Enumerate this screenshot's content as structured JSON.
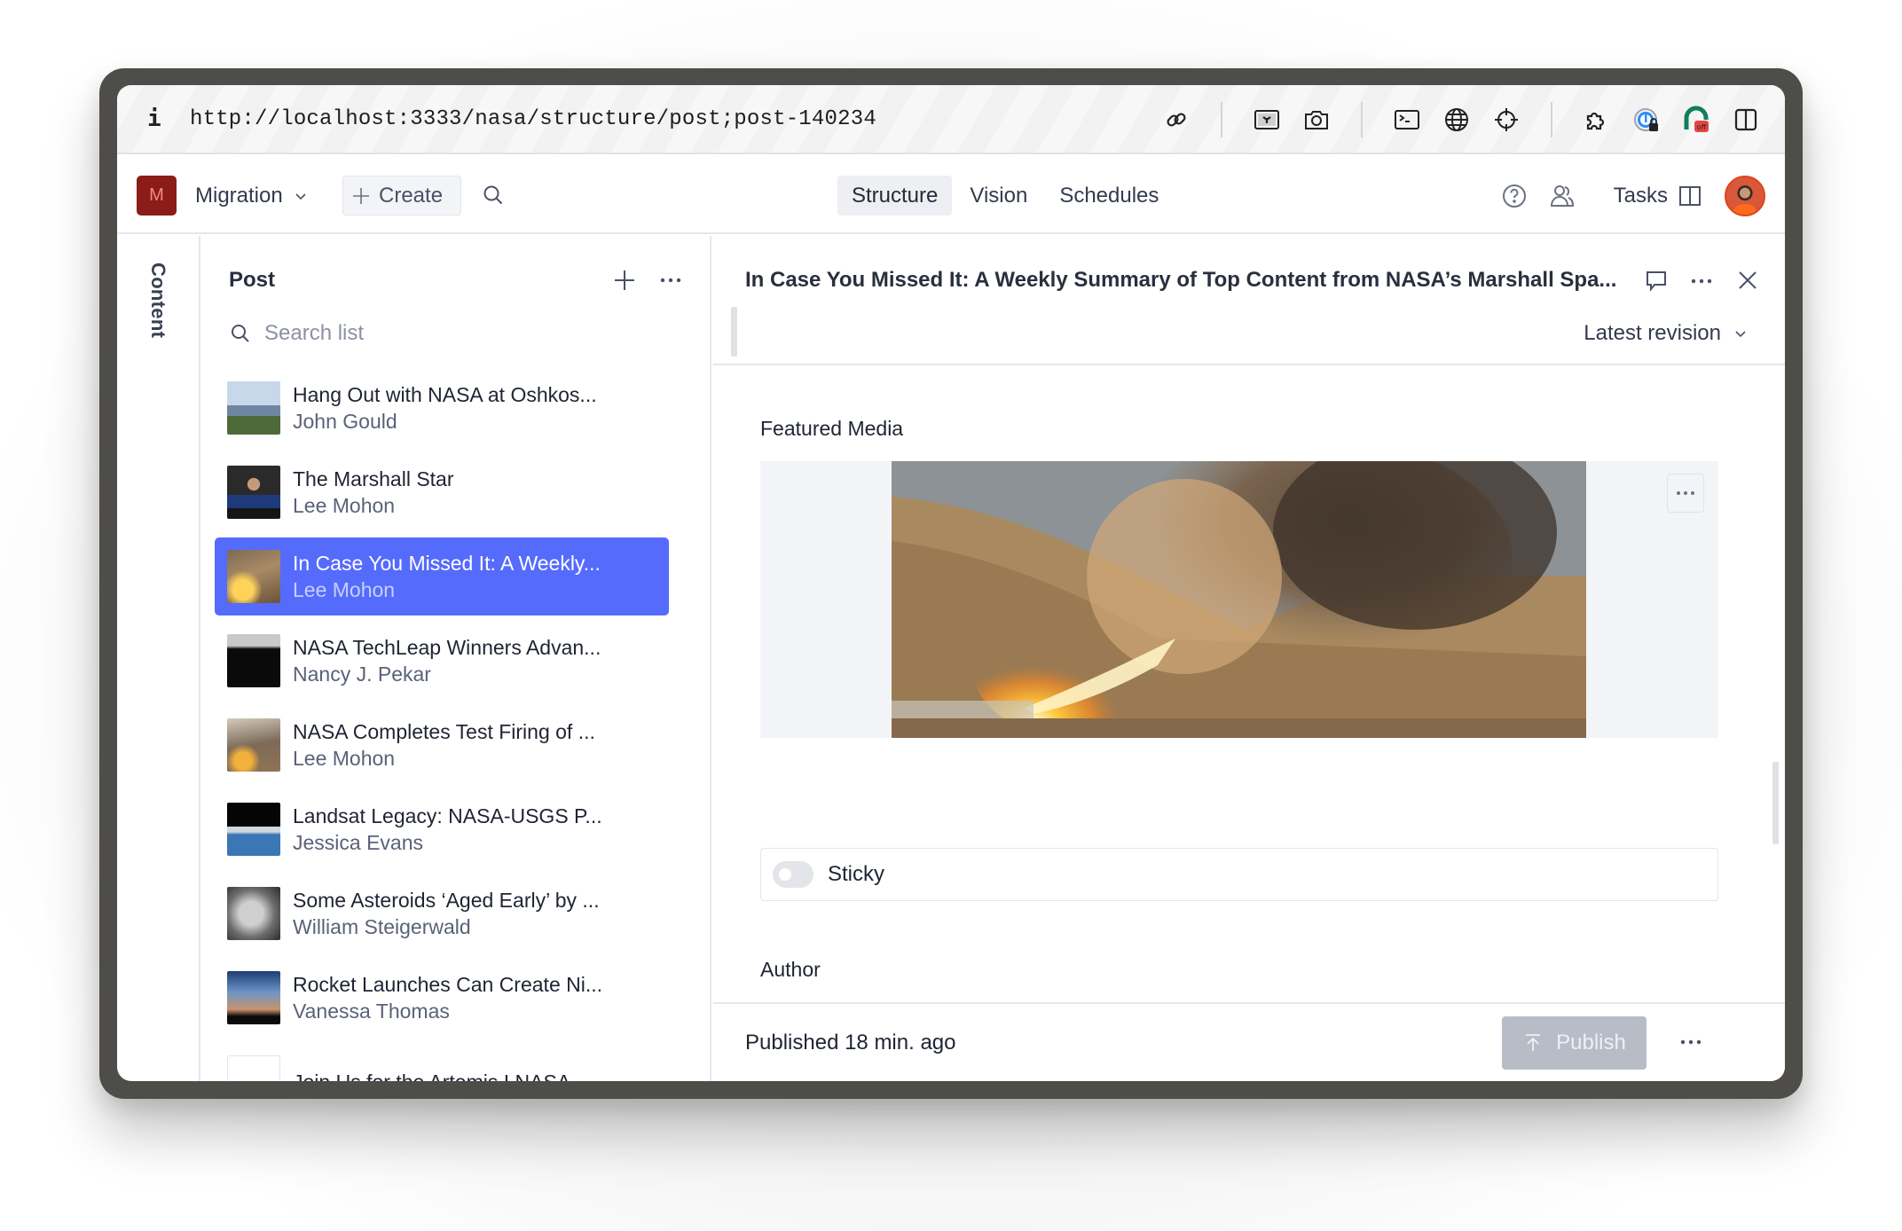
{
  "browser": {
    "info_glyph": "i",
    "url": "http://localhost:3333/nasa/structure/post;post-140234",
    "toolbar_icons": [
      "link-icon",
      "image-picker-icon",
      "camera-icon",
      "terminal-icon",
      "globe-icon",
      "crosshair-icon",
      "extensions-icon",
      "password-manager-icon",
      "extension-off-icon",
      "sidebar-icon"
    ],
    "extension_badge": "off"
  },
  "header": {
    "workspace_initial": "M",
    "workspace_name": "Migration",
    "create_label": "Create",
    "tabs": [
      {
        "label": "Structure",
        "active": true
      },
      {
        "label": "Vision",
        "active": false
      },
      {
        "label": "Schedules",
        "active": false
      }
    ],
    "tasks_label": "Tasks",
    "brand_color": "#8c1c17"
  },
  "rail": {
    "label": "Content"
  },
  "list": {
    "title": "Post",
    "search_placeholder": "Search list",
    "search_value": "",
    "selected_color": "#556bfc",
    "items": [
      {
        "title": "Hang Out with NASA at Oshkos...",
        "author": "John Gould",
        "thumb": "crowd-outdoor",
        "selected": false
      },
      {
        "title": "The Marshall Star",
        "author": "Lee Mohon",
        "thumb": "podium-stage",
        "selected": false
      },
      {
        "title": "In Case You Missed It: A Weekly...",
        "author": "Lee Mohon",
        "thumb": "rocket-test-fire",
        "selected": true
      },
      {
        "title": "NASA TechLeap Winners Advan...",
        "author": "Nancy J. Pekar",
        "thumb": "dark-sky",
        "selected": false
      },
      {
        "title": "NASA Completes Test Firing of ...",
        "author": "Lee Mohon",
        "thumb": "rocket-smoke",
        "selected": false
      },
      {
        "title": "Landsat Legacy: NASA-USGS P...",
        "author": "Jessica Evans",
        "thumb": "satellite-earth",
        "selected": false
      },
      {
        "title": "Some Asteroids ‘Aged Early’ by ...",
        "author": "William Steigerwald",
        "thumb": "asteroid-surface",
        "selected": false
      },
      {
        "title": "Rocket Launches Can Create Ni...",
        "author": "Vanessa Thomas",
        "thumb": "night-clouds",
        "selected": false
      },
      {
        "title": "Join Us for the Artemis I NASA ...",
        "author": "",
        "thumb": "edit-placeholder",
        "selected": false
      }
    ]
  },
  "detail": {
    "title": "In Case You Missed It: A Weekly Summary of Top Content from NASA’s Marshall Spa...",
    "revision_label": "Latest revision",
    "featured_media_label": "Featured Media",
    "featured_media_alt": "Rocket motor test firing with flame and smoke plume over desert hills",
    "sticky_label": "Sticky",
    "sticky_checked": false,
    "author_label": "Author",
    "status_text": "Published 18 min. ago",
    "publish_label": "Publish",
    "publish_disabled": true
  }
}
